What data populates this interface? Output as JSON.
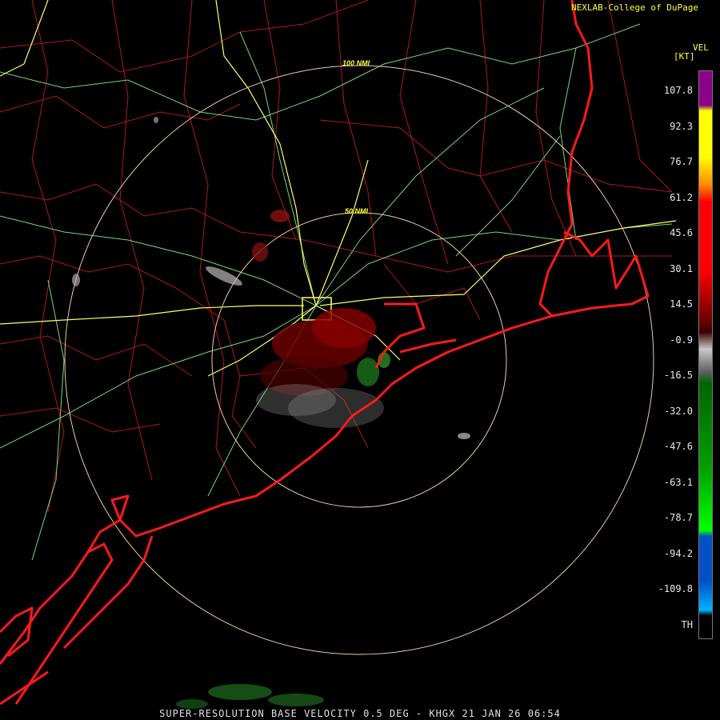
{
  "header": {
    "credit": "NEXLAB-College of DuPage",
    "product_code": "VEL",
    "units": "[KT]"
  },
  "rings": [
    {
      "label": "100 NMI"
    },
    {
      "label": "50 NMI"
    }
  ],
  "legend": {
    "ticks": [
      "107.8",
      "92.3",
      "76.7",
      "61.2",
      "45.6",
      "30.1",
      "14.5",
      "-0.9",
      "-16.5",
      "-32.0",
      "-47.6",
      "-63.1",
      "-78.7",
      "-94.2",
      "-109.8",
      "TH"
    ],
    "colors": {
      "purple": "#8b008b",
      "yellow": "#ffff00",
      "red": "#ff0000",
      "darkred": "#6b0000",
      "gray": "#c8c8c8",
      "green": "#006400",
      "brightgreen": "#00ff00",
      "blue": "#0050c8",
      "cyan": "#00b4ff"
    }
  },
  "map": {
    "coastline_color": "#ff1a1a",
    "county_color": "#b01818",
    "highway_color": "#ffff66",
    "road_color": "#7ad37a",
    "ring_color": "#f0c8a0"
  },
  "footer": {
    "caption": "SUPER-RESOLUTION BASE VELOCITY 0.5 DEG - KHGX 21 JAN 26 06:54"
  }
}
